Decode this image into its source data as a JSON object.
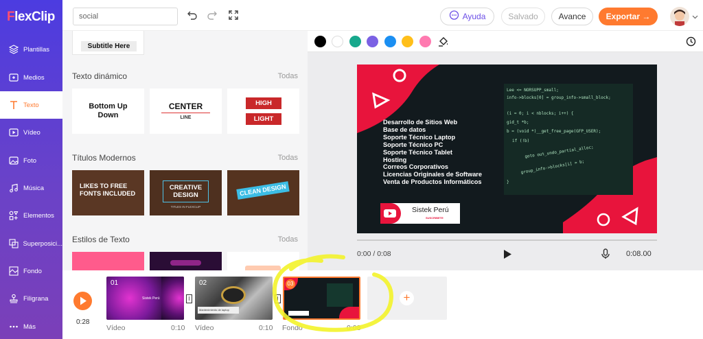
{
  "app": {
    "logo_prefix": "F",
    "logo_rest": "lexClip"
  },
  "sidebar": {
    "items": [
      {
        "label": "Plantillas",
        "icon": "layers-icon"
      },
      {
        "label": "Medios",
        "icon": "media-icon"
      },
      {
        "label": "Texto",
        "icon": "text-icon"
      },
      {
        "label": "Vídeo",
        "icon": "video-icon"
      },
      {
        "label": "Foto",
        "icon": "photo-icon"
      },
      {
        "label": "Música",
        "icon": "music-icon"
      },
      {
        "label": "Elementos",
        "icon": "elements-icon"
      },
      {
        "label": "Superposici...",
        "icon": "overlay-icon"
      },
      {
        "label": "Fondo",
        "icon": "background-icon"
      },
      {
        "label": "Filigrana",
        "icon": "watermark-icon"
      },
      {
        "label": "Más",
        "icon": "more-icon"
      }
    ],
    "active_index": 2
  },
  "topbar": {
    "search_value": "social",
    "help_label": "Ayuda",
    "saved_label": "Salvado",
    "advance_label": "Avance",
    "export_label": "Exportar →"
  },
  "panel": {
    "top_card_text": "Subtitle Here",
    "sections": [
      {
        "title": "Texto dinámico",
        "all": "Todas"
      },
      {
        "title": "Títulos Modernos",
        "all": "Todas"
      },
      {
        "title": "Estilos de Texto",
        "all": "Todas"
      }
    ],
    "dynamic_cards": [
      "Bottom Up Down",
      "CENTER",
      "LINE",
      "HIGH",
      "LIGHT"
    ],
    "modern_cards": [
      "LIKES TO FREE FONTS INCLUDED",
      "CREATIVE DESIGN",
      "TITLES IN FLEXCLIP",
      "CLEAN DESIGN"
    ]
  },
  "colors": [
    "#000000",
    "#ffffff",
    "#17a88c",
    "#7b61e4",
    "#1b8ff2",
    "#ffbf1a",
    "#ff7ab0"
  ],
  "video": {
    "lines": [
      "Desarrollo de Sitios Web",
      "Base de datos",
      "Soporte Técnico Laptop",
      "Soporte Técnico PC",
      "Soporte Técnico Tablet",
      "Hosting",
      "Correos Corporativos",
      "Licencias Originales de Software",
      "Venta de Productos Informáticos"
    ],
    "brand": "Sistek Perú",
    "subscribe": "SUSCRIBETE",
    "code_lines": [
      "Lee <= NORSUPP_small;",
      "info->blocks[0] = group_info->small_block;",
      "",
      "(i = 0; i < nblocks; i++) {",
      "gid_t *b;",
      "b = (void *)__get_free_page(GFP_USER);",
      "if (!b)",
      "goto out_undo_partial_alloc;",
      "group_info->blocks[i] = b;",
      "}"
    ]
  },
  "player": {
    "current": "0:00 / 0:08",
    "duration": "0:08.00"
  },
  "timeline": {
    "total": "0:28",
    "clips": [
      {
        "num": "01",
        "label": "Vídeo",
        "dur": "0:10"
      },
      {
        "num": "02",
        "label": "Vídeo",
        "dur": "0:10"
      },
      {
        "num": "03",
        "label": "Fondo",
        "dur": "0:08"
      }
    ],
    "transition_glyph": "I",
    "clip1_brand": "Sistek Perú",
    "clip2_caption": "Mantenimiento de laptop"
  }
}
